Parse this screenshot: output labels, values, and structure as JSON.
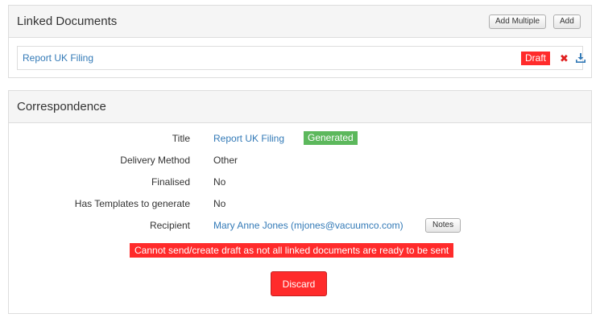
{
  "linked_documents": {
    "title": "Linked Documents",
    "add_multiple_label": "Add Multiple",
    "add_label": "Add",
    "documents": [
      {
        "name": "Report UK Filing",
        "status": "Draft",
        "status_color": "#ff2b2b"
      }
    ]
  },
  "correspondence": {
    "title": "Correspondence",
    "fields": {
      "title_label": "Title",
      "title_value": "Report UK Filing",
      "title_badge": "Generated",
      "delivery_label": "Delivery Method",
      "delivery_value": "Other",
      "finalised_label": "Finalised",
      "finalised_value": "No",
      "templates_label": "Has Templates to generate",
      "templates_value": "No",
      "recipient_label": "Recipient",
      "recipient_value": "Mary Anne Jones (mjones@vacuumco.com)",
      "notes_label": "Notes"
    },
    "error_message": "Cannot send/create draft as not all linked documents are ready to be sent",
    "discard_label": "Discard"
  },
  "colors": {
    "accent_link": "#337ab7",
    "danger": "#ff2b2b",
    "success": "#5cb85c"
  },
  "icons": {
    "remove": "remove-icon",
    "download": "download-icon"
  }
}
